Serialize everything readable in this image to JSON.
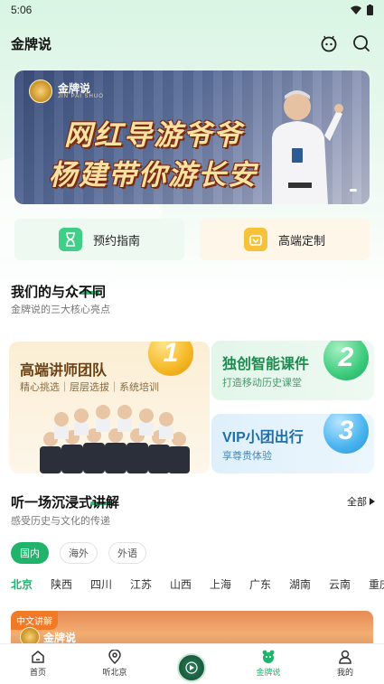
{
  "status": {
    "time": "5:06"
  },
  "header": {
    "title": "金牌说",
    "icons": [
      "robot-service-icon",
      "search-icon"
    ]
  },
  "banner": {
    "logo_text": "金牌说",
    "logo_sub": "JIN PAI SHUO",
    "line1": "网红导游爷爷",
    "line2": "杨建带你游长安"
  },
  "quick": {
    "booking": "预约指南",
    "custom": "高端定制"
  },
  "features": {
    "title": "我们的与众不同",
    "subtitle": "金牌说的三大核心亮点",
    "cards": [
      {
        "num": "1",
        "title": "高端讲师团队",
        "sub": "精心挑选｜层层选拔｜系统培训"
      },
      {
        "num": "2",
        "title": "独创智能课件",
        "sub": "打造移动历史课堂"
      },
      {
        "num": "3",
        "title": "VIP小团出行",
        "sub": "享尊贵体验"
      }
    ]
  },
  "listen": {
    "title": "听一场沉浸式讲解",
    "subtitle": "感受历史与文化的传递",
    "all": "全部",
    "chips": [
      "国内",
      "海外",
      "外语"
    ],
    "provinces": [
      "北京",
      "陕西",
      "四川",
      "江苏",
      "山西",
      "上海",
      "广东",
      "湖南",
      "云南",
      "重庆"
    ]
  },
  "video": {
    "tag": "中文讲解",
    "logo_text": "金牌说"
  },
  "tabbar": {
    "items": [
      {
        "label": "首页",
        "icon": "home-icon"
      },
      {
        "label": "听北京",
        "icon": "location-icon"
      },
      {
        "label": "",
        "icon": "play-icon"
      },
      {
        "label": "金牌说",
        "icon": "bear-icon"
      },
      {
        "label": "我的",
        "icon": "user-icon"
      }
    ],
    "active": "金牌说"
  },
  "colors": {
    "accent": "#1fb36c",
    "gold": "#f5b824",
    "blue": "#47b3ee"
  }
}
